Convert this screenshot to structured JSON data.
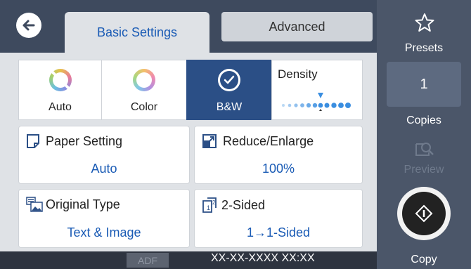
{
  "tabs": {
    "basic": "Basic Settings",
    "advanced": "Advanced"
  },
  "color_modes": [
    {
      "label": "Auto"
    },
    {
      "label": "Color"
    },
    {
      "label": "B&W"
    }
  ],
  "density": {
    "label": "Density"
  },
  "settings": {
    "paper": {
      "title": "Paper Setting",
      "value": "Auto"
    },
    "reduce": {
      "title": "Reduce/Enlarge",
      "value": "100%"
    },
    "original": {
      "title": "Original Type",
      "value": "Text & Image"
    },
    "sided": {
      "title": "2-Sided",
      "value": "1→1-Sided"
    }
  },
  "status": {
    "adf": "ADF",
    "datetime": "XX-XX-XXXX XX:XX"
  },
  "side": {
    "presets": "Presets",
    "copies_value": "1",
    "copies_label": "Copies",
    "preview": "Preview",
    "copy": "Copy"
  },
  "colors": {
    "accent": "#1a5bb5",
    "selected": "#2b4f86",
    "sidebar": "#4b5669",
    "topbar": "#3e4a5e"
  }
}
